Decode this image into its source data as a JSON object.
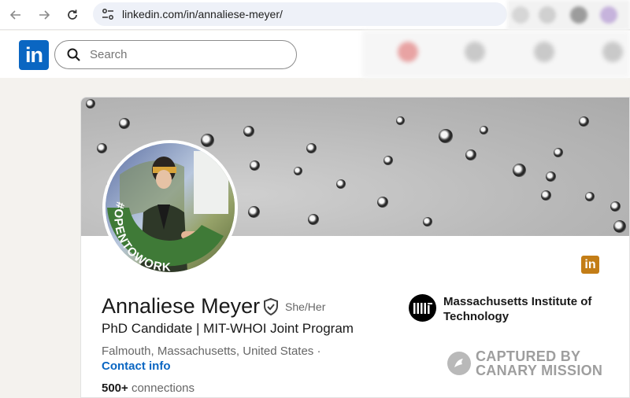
{
  "browser": {
    "url": "linkedin.com/in/annaliese-meyer/"
  },
  "header": {
    "logo_text": "in",
    "search_placeholder": "Search"
  },
  "profile": {
    "name": "Annaliese Meyer",
    "pronouns": "She/Her",
    "headline": "PhD Candidate | MIT-WHOI Joint Program",
    "location": "Falmouth, Massachusetts, United States ·",
    "contact_link": "Contact info",
    "connections_count": "500+",
    "connections_label": " connections",
    "open_to_work_badge": "#OPENTOWORK",
    "linkedin_badge_text": "in"
  },
  "education": {
    "school": "Massachusetts Institute of Technology"
  },
  "watermark": {
    "line1": "CAPTURED BY",
    "line2": "CANARY MISSION"
  },
  "colors": {
    "linkedin_blue": "#0a66c2",
    "open_to_work_green": "#3f7a37",
    "premium_gold": "#c37d16"
  }
}
